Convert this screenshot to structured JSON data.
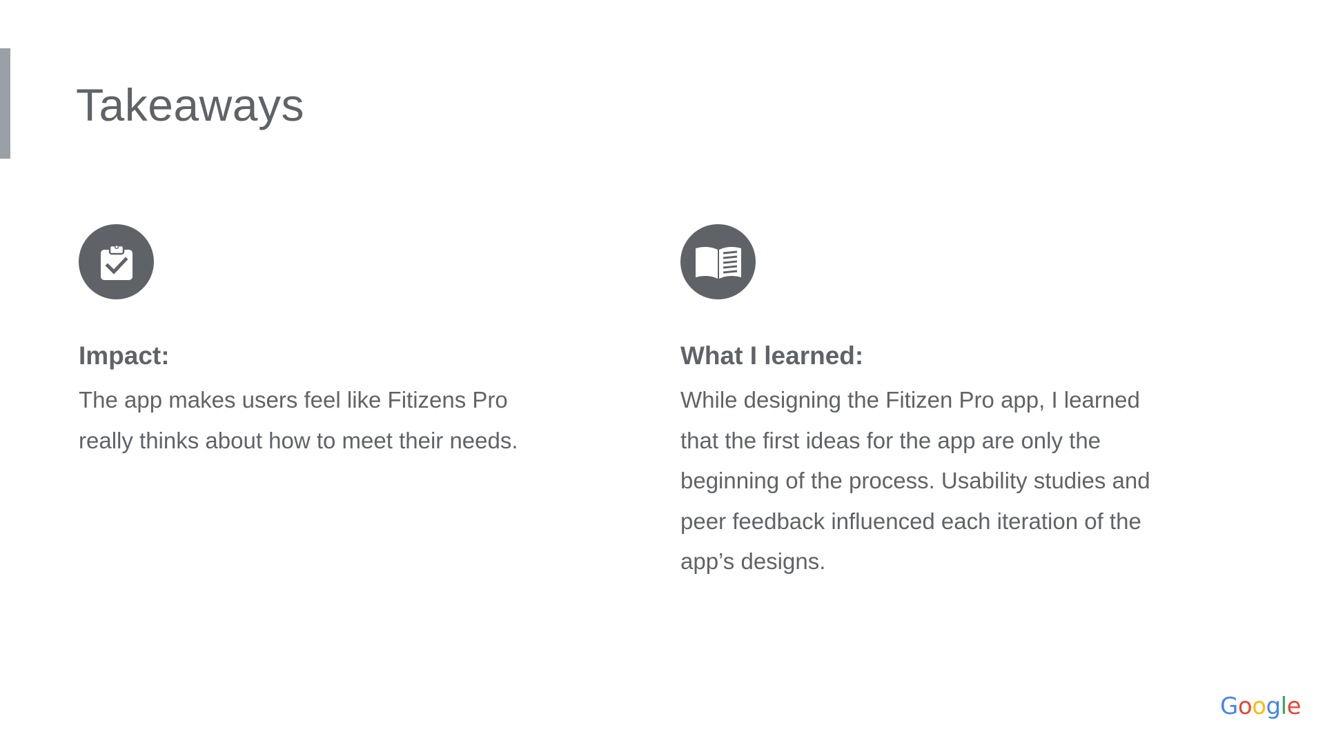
{
  "slide": {
    "title": "Takeaways"
  },
  "sections": [
    {
      "icon": "clipboard-check-icon",
      "heading": "Impact:",
      "body": "The app makes users feel like Fitizens Pro really thinks about how to meet their needs."
    },
    {
      "icon": "open-book-icon",
      "heading": "What I learned:",
      "body": "While designing the Fitizen Pro app, I learned that the first ideas for the app are only the beginning of the process. Usability studies and peer feedback influenced each iteration of the app’s designs."
    }
  ],
  "logo": {
    "text": "Google",
    "colors": [
      "#4285F4",
      "#EA4335",
      "#FBBC05",
      "#4285F4",
      "#34A853",
      "#EA4335"
    ]
  },
  "colors": {
    "text": "#5f6368",
    "icon_background": "#5f6368",
    "accent_bar": "#9aa0a6",
    "background": "#ffffff"
  }
}
